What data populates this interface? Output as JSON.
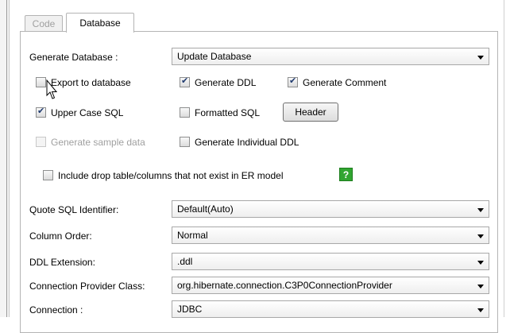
{
  "tabs": [
    {
      "label": "Code",
      "active": false
    },
    {
      "label": "Database",
      "active": true
    }
  ],
  "generate_database": {
    "label": "Generate Database :",
    "value": "Update Database"
  },
  "checkboxes": {
    "export_to_database": {
      "label": "Export to database",
      "checked": false
    },
    "generate_ddl": {
      "label": "Generate DDL",
      "checked": true
    },
    "generate_comment": {
      "label": "Generate Comment",
      "checked": true
    },
    "upper_case_sql": {
      "label": "Upper Case SQL",
      "checked": true
    },
    "formatted_sql": {
      "label": "Formatted SQL",
      "checked": false
    },
    "generate_sample_data": {
      "label": "Generate sample data",
      "checked": false,
      "disabled": true
    },
    "generate_individual_ddl": {
      "label": "Generate Individual DDL",
      "checked": false
    },
    "include_drop_table": {
      "label": "Include drop table/columns that not exist in ER model",
      "checked": false
    }
  },
  "header_button": {
    "label": "Header"
  },
  "help_icon": {
    "glyph": "?",
    "color": "#31a531"
  },
  "fields": {
    "quote_sql_identifier": {
      "label": "Quote SQL Identifier:",
      "value": "Default(Auto)"
    },
    "column_order": {
      "label": "Column Order:",
      "value": "Normal"
    },
    "ddl_extension": {
      "label": "DDL Extension:",
      "value": ".ddl"
    },
    "connection_provider_class": {
      "label": "Connection Provider Class:",
      "value": "org.hibernate.connection.C3P0ConnectionProvider"
    },
    "connection": {
      "label": "Connection :",
      "value": "JDBC"
    }
  }
}
